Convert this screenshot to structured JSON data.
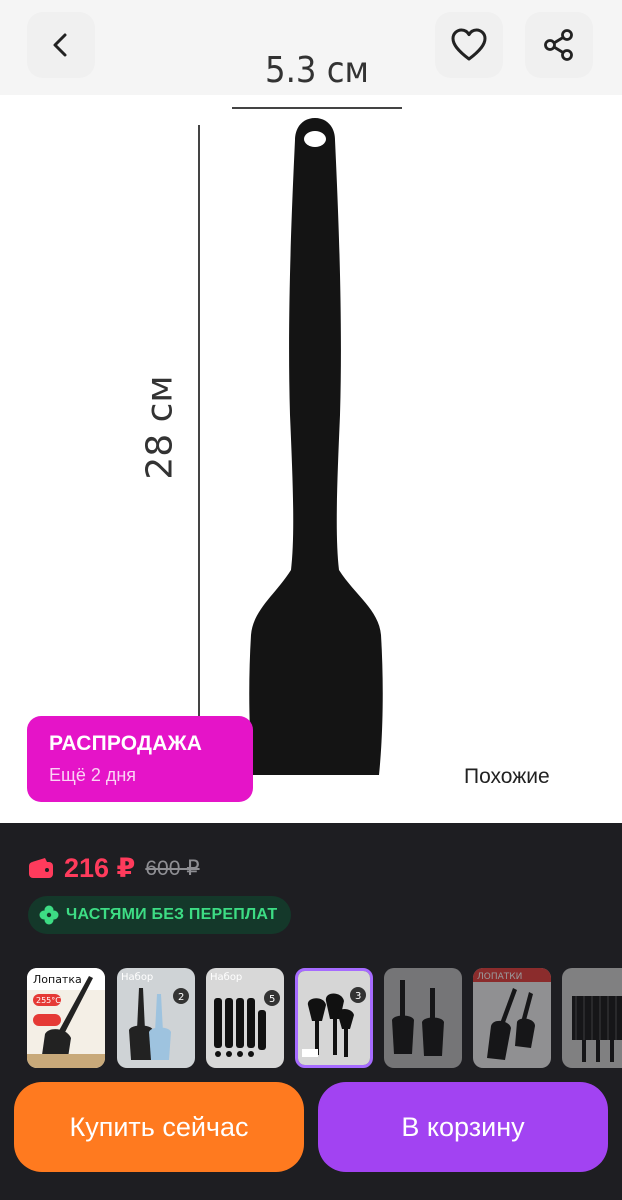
{
  "top_bar": {
    "icons": {
      "back": "chevron-left-icon",
      "favorite": "heart-icon",
      "share": "share-icon"
    }
  },
  "product_image": {
    "width_label": "5.3 см",
    "height_label": "28 см"
  },
  "sale_badge": {
    "title": "РАСПРОДАЖА",
    "subtitle": "Ещё 2 дня",
    "color": "#e514c8"
  },
  "similar_link": "Похожие",
  "price": {
    "current": "216 ₽",
    "old": "600 ₽",
    "current_color": "#ff3b5c"
  },
  "installment": {
    "label": "ЧАСТЯМИ БЕЗ ПЕРЕПЛАТ",
    "color": "#3ddc84"
  },
  "thumbnails": {
    "selected_index": 3,
    "items": [
      {
        "caption": "Лопатка",
        "badge": "255°C"
      },
      {
        "caption": "Набор",
        "badge": "2"
      },
      {
        "caption": "Набор",
        "badge": "5"
      },
      {
        "caption": "",
        "badge": "3"
      },
      {
        "caption": "",
        "badge": ""
      },
      {
        "caption": "ЛОПАТКИ",
        "badge": ""
      },
      {
        "caption": "",
        "badge": ""
      }
    ]
  },
  "actions": {
    "buy_now": "Купить сейчас",
    "add_to_cart": "В корзину",
    "buy_color": "#ff7a1f",
    "cart_color": "#a243f2"
  }
}
